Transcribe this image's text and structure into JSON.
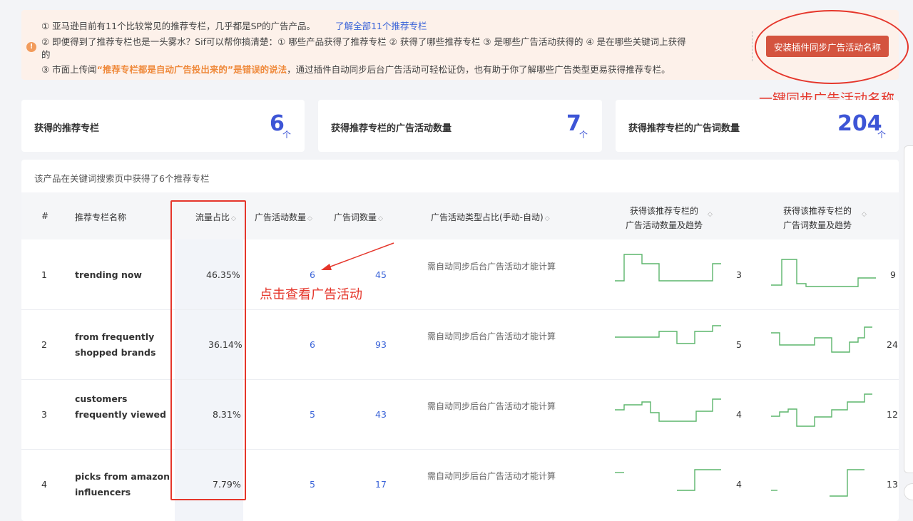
{
  "notice": {
    "line1": "① 亚马逊目前有11个比较常见的推荐专栏，几乎都是SP的广告产品。",
    "line1_link": "了解全部11个推荐专栏",
    "line2": "② 即便得到了推荐专栏也是一头雾水？Sif可以帮你搞清楚：① 哪些产品获得了推荐专栏  ② 获得了哪些推荐专栏  ③ 是哪些广告活动获得的    ④ 是在哪些关键词上获得",
    "line2_wrap": "的",
    "line3_pre": "③ 市面上传闻",
    "line3_highlight": "“推荐专栏都是自动广告投出来的”是错误的说法",
    "line3_post": "，通过插件自动同步后台广告活动可轻松证伪，也有助于你了解哪些广告类型更易获得推荐专栏。",
    "button": "安装插件同步广告活动名称",
    "warn_icon": "!"
  },
  "annotations": {
    "top": "一键同步广告活动名称",
    "middle": "点击查看广告活动"
  },
  "stats": [
    {
      "label": "获得的推荐专栏",
      "value": "6",
      "unit": "个"
    },
    {
      "label": "获得推荐专栏的广告活动数量",
      "value": "7",
      "unit": "个"
    },
    {
      "label": "获得推荐专栏的广告词数量",
      "value": "204",
      "unit": "个"
    }
  ],
  "table": {
    "caption": "该产品在关键词搜索页中获得了6个推荐专栏",
    "headers": {
      "index": "#",
      "name": "推荐专栏名称",
      "traffic": "流量占比",
      "campaigns": "广告活动数量",
      "keywords": "广告词数量",
      "type_ratio": "广告活动类型占比(手动-自动)",
      "campaign_trend_1": "获得该推荐专栏的",
      "campaign_trend_2": "广告活动数量及趋势",
      "keyword_trend_1": "获得该推荐专栏的",
      "keyword_trend_2": "广告词数量及趋势"
    },
    "sort_icon": "◇",
    "rows": [
      {
        "index": "1",
        "name1": "trending now",
        "name2": "",
        "traffic": "46.35%",
        "campaigns": "6",
        "keywords": "45",
        "type_ratio": "需自动同步后台广告活动才能计算",
        "campaign_now": "3",
        "keyword_now": "9"
      },
      {
        "index": "2",
        "name1": "from frequently",
        "name2": "shopped brands",
        "traffic": "36.14%",
        "campaigns": "6",
        "keywords": "93",
        "type_ratio": "需自动同步后台广告活动才能计算",
        "campaign_now": "5",
        "keyword_now": "24"
      },
      {
        "index": "3",
        "name1": "customers",
        "name2": "frequently viewed",
        "traffic": "8.31%",
        "campaigns": "5",
        "keywords": "43",
        "type_ratio": "需自动同步后台广告活动才能计算",
        "campaign_now": "4",
        "keyword_now": "12"
      },
      {
        "index": "4",
        "name1": "picks from amazon",
        "name2": "influencers",
        "traffic": "7.79%",
        "campaigns": "5",
        "keywords": "17",
        "type_ratio": "需自动同步后台广告活动才能计算",
        "campaign_now": "4",
        "keyword_now": "13"
      }
    ]
  },
  "colors": {
    "accent": "#3d55d6",
    "link": "#3a63d8",
    "annotation": "#e5362b",
    "button": "#d4543f",
    "sparkline": "#5cb56b",
    "notice_bg": "#fdf1ea"
  }
}
